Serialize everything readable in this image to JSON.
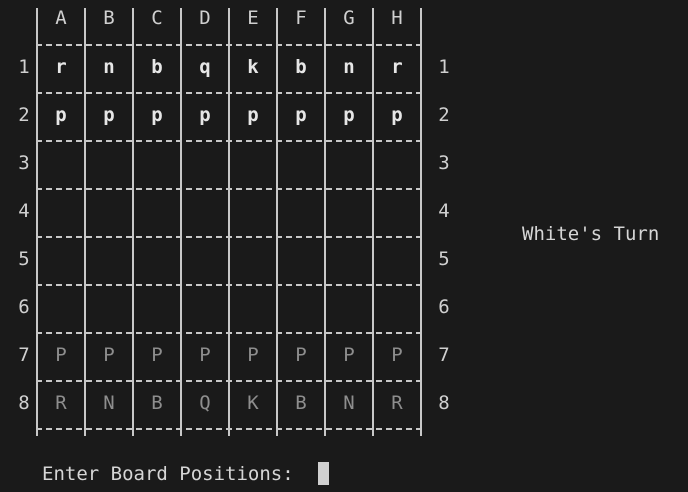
{
  "board": {
    "columns": [
      "A",
      "B",
      "C",
      "D",
      "E",
      "F",
      "G",
      "H"
    ],
    "rows": [
      "1",
      "2",
      "3",
      "4",
      "5",
      "6",
      "7",
      "8"
    ],
    "pieces": [
      [
        "r",
        "n",
        "b",
        "q",
        "k",
        "b",
        "n",
        "r"
      ],
      [
        "p",
        "p",
        "p",
        "p",
        "p",
        "p",
        "p",
        "p"
      ],
      [
        "",
        "",
        "",
        "",
        "",
        "",
        "",
        ""
      ],
      [
        "",
        "",
        "",
        "",
        "",
        "",
        "",
        ""
      ],
      [
        "",
        "",
        "",
        "",
        "",
        "",
        "",
        ""
      ],
      [
        "",
        "",
        "",
        "",
        "",
        "",
        "",
        ""
      ],
      [
        "P",
        "P",
        "P",
        "P",
        "P",
        "P",
        "P",
        "P"
      ],
      [
        "R",
        "N",
        "B",
        "Q",
        "K",
        "B",
        "N",
        "R"
      ]
    ]
  },
  "status": {
    "turn_text": "White's Turn"
  },
  "prompt": {
    "label": "Enter Board Positions:",
    "value": ""
  },
  "colors": {
    "background": "#1a1a1a",
    "text": "#d0d0d0",
    "black_pieces": "#e6e6e6",
    "white_pieces": "#8e8e8e"
  }
}
